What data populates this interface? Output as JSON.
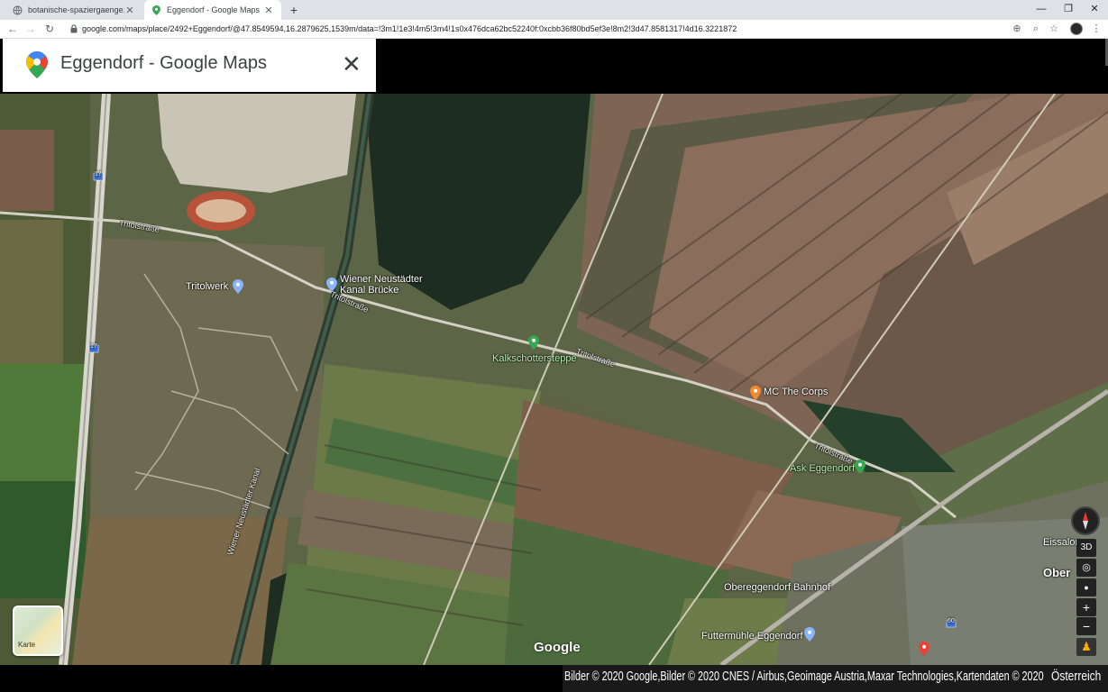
{
  "browser": {
    "tabs": [
      {
        "title": "botanische-spaziergaenge.at - Fo",
        "active": false
      },
      {
        "title": "Eggendorf - Google Maps",
        "active": true
      }
    ],
    "new_tab": "+",
    "url": "google.com/maps/place/2492+Eggendorf/@47.8549594,16.2879625,1539m/data=!3m1!1e3!4m5!3m4!1s0x476dca62bc52240f:0xcbb36f80bd5ef3e!8m2!3d47.8581317!4d16.3221872",
    "window_controls": {
      "minimize": "—",
      "restore": "❐",
      "close": "✕"
    }
  },
  "header": {
    "title": "Eggendorf - Google Maps",
    "close_glyph": "✕"
  },
  "map": {
    "labels": {
      "tritolstrasse_1": "Tritolstraße",
      "tritolstrasse_2": "Tritolstraße",
      "tritolstrasse_3": "Tritolstraße",
      "tritolstrasse_4": "Tritolstraße",
      "tritolwerk": "Tritolwerk",
      "wiener_neustaedter_1": "Wiener Neustädter",
      "wiener_neustaedter_2": "Kanal Brücke",
      "kalkschottersteppe": "Kalkschottersteppe",
      "mc_the_corps": "MC The Corps",
      "ask_eggendorf": "Ask Eggendorf",
      "obereggendorf_bahnhof": "Obereggendorf Bahnhof",
      "futtermuehle": "Futtermühle Eggendorf",
      "eissalon": "Eissalon",
      "ober": "Ober",
      "kanal_road": "Wiener Neustädter Kanal",
      "route_17a": "17",
      "route_17b": "17",
      "route_60": "60"
    },
    "google_logo": "Google",
    "layer_switch_label": "Karte",
    "controls": {
      "three_d": "3D",
      "zoom_in": "+",
      "zoom_out": "−"
    },
    "colors": {
      "pin_green": "#34a853",
      "pin_orange": "#f28b30",
      "pin_blue": "#8ab4f8",
      "pin_red": "#ea4335"
    }
  },
  "footer": {
    "attribution": "Bilder © 2020 Google,Bilder © 2020 CNES / Airbus,Geoimage Austria,Maxar Technologies,Kartendaten © 2020",
    "country": "Österreich"
  }
}
